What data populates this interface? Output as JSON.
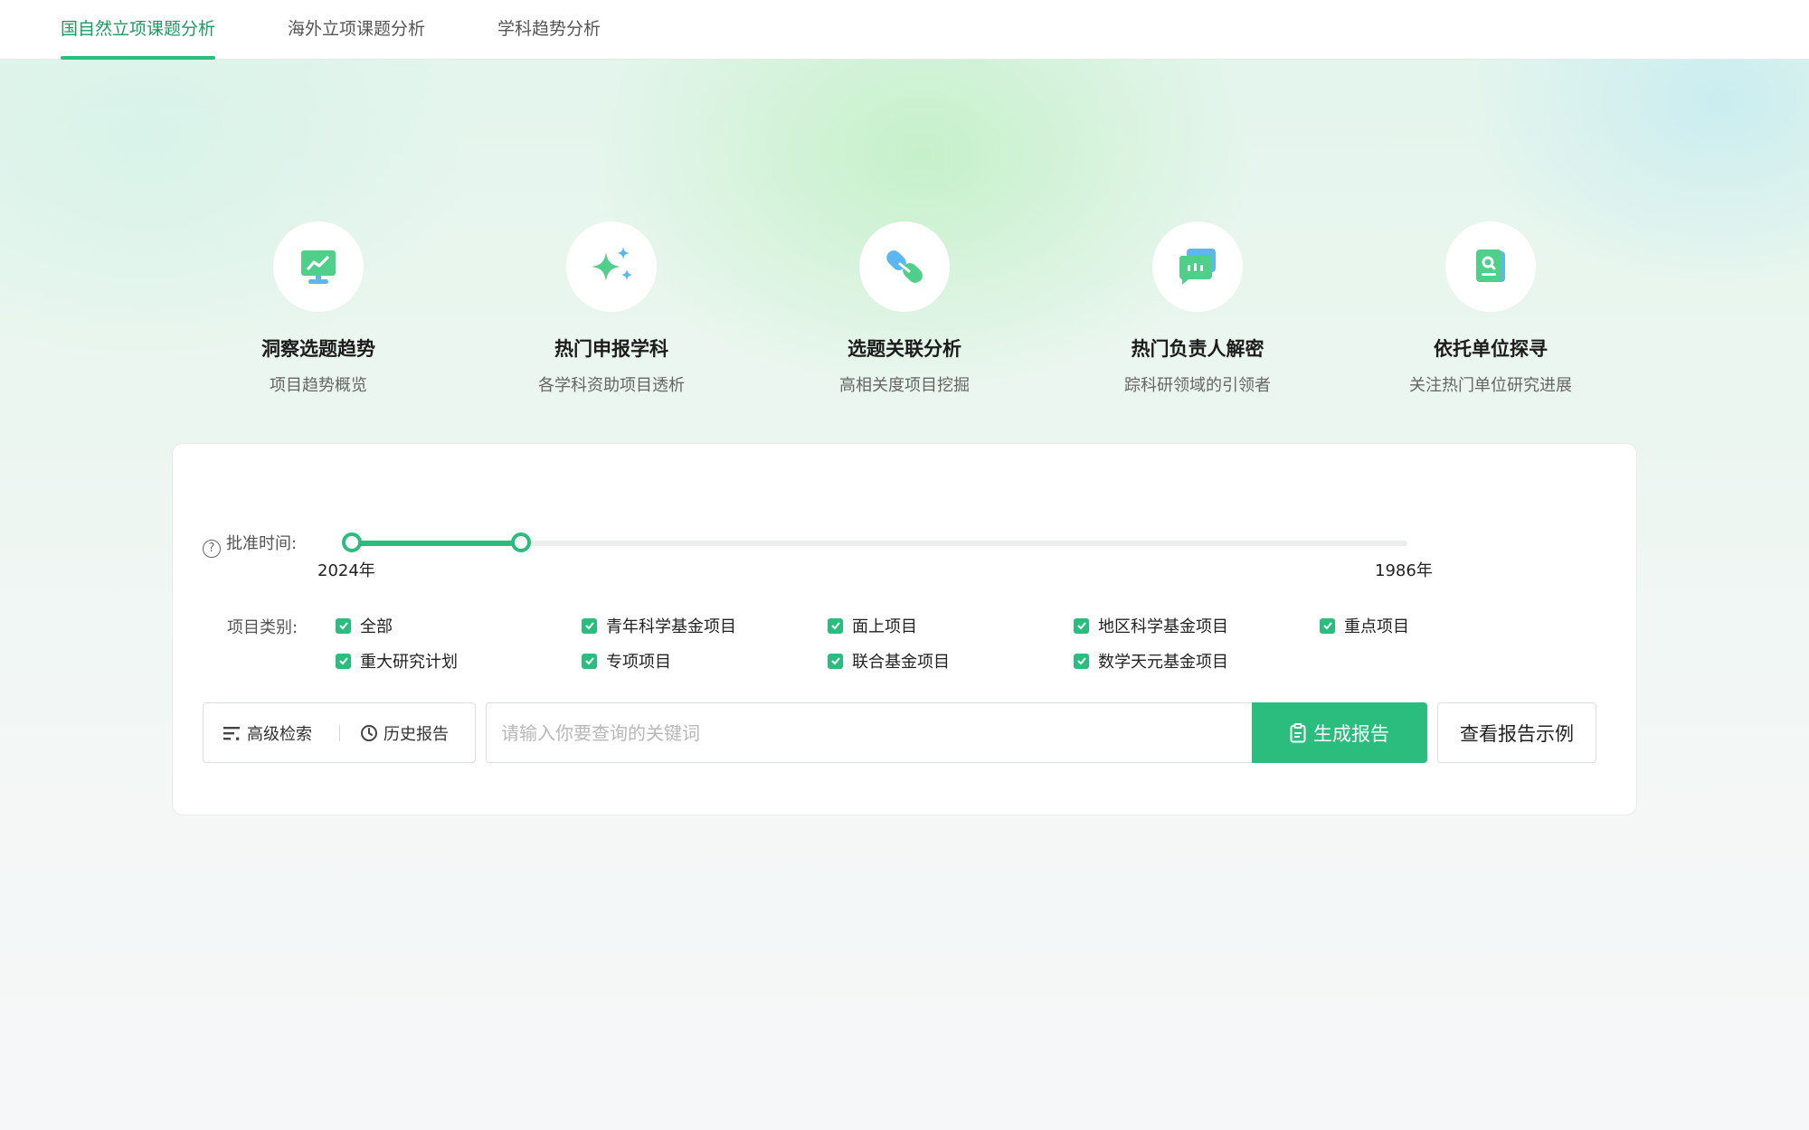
{
  "tabs": [
    {
      "label": "国自然立项课题分析",
      "active": true
    },
    {
      "label": "海外立项课题分析",
      "active": false
    },
    {
      "label": "学科趋势分析",
      "active": false
    }
  ],
  "features": [
    {
      "title": "洞察选题趋势",
      "subtitle": "项目趋势概览",
      "icon": "monitor-trend-icon"
    },
    {
      "title": "热门申报学科",
      "subtitle": "各学科资助项目透析",
      "icon": "sparkle-icon"
    },
    {
      "title": "选题关联分析",
      "subtitle": "高相关度项目挖掘",
      "icon": "link-icon"
    },
    {
      "title": "热门负责人解密",
      "subtitle": "踪科研领域的引领者",
      "icon": "chat-bubbles-icon"
    },
    {
      "title": "依托单位探寻",
      "subtitle": "关注热门单位研究进展",
      "icon": "book-search-icon"
    }
  ],
  "filters": {
    "time_label": "批准时间:",
    "time_range": {
      "start_mark": "2024年",
      "end_mark": "1986年",
      "selected_fraction": [
        0.0,
        0.159
      ]
    },
    "category_label": "项目类别:",
    "categories": [
      {
        "label": "全部",
        "checked": true
      },
      {
        "label": "青年科学基金项目",
        "checked": true
      },
      {
        "label": "面上项目",
        "checked": true
      },
      {
        "label": "地区科学基金项目",
        "checked": true
      },
      {
        "label": "重点项目",
        "checked": true
      },
      {
        "label": "重大研究计划",
        "checked": true
      },
      {
        "label": "专项项目",
        "checked": true
      },
      {
        "label": "联合基金项目",
        "checked": true
      },
      {
        "label": "数学天元基金项目",
        "checked": true
      }
    ]
  },
  "search": {
    "advanced_label": "高级检索",
    "history_label": "历史报告",
    "placeholder": "请输入你要查询的关键词",
    "generate_label": "生成报告",
    "example_label": "查看报告示例"
  },
  "colors": {
    "accent": "#2bbd7e",
    "accent_text": "#1d9a62"
  }
}
